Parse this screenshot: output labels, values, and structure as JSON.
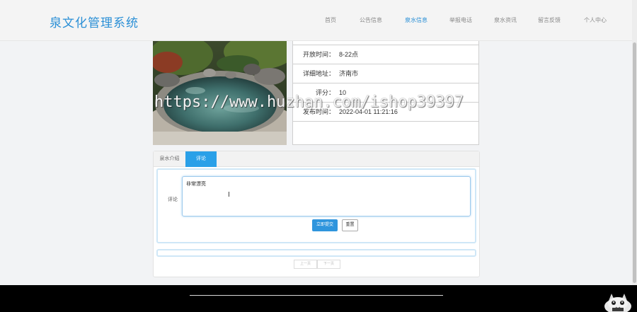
{
  "header": {
    "logo": "泉文化管理系统",
    "nav": [
      {
        "label": "首页",
        "active": false
      },
      {
        "label": "公告信息",
        "active": false
      },
      {
        "label": "泉水信息",
        "active": true
      },
      {
        "label": "举报电话",
        "active": false
      },
      {
        "label": "泉水资讯",
        "active": false
      },
      {
        "label": "留言反馈",
        "active": false
      },
      {
        "label": "个人中心",
        "active": false
      }
    ]
  },
  "details": {
    "rows": [
      {
        "label": "开放时间：",
        "value": "8-22点"
      },
      {
        "label": "详细地址：",
        "value": "济南市"
      },
      {
        "label": "评分：",
        "value": "10"
      },
      {
        "label": "发布时间：",
        "value": "2022-04-01 11:21:16"
      }
    ]
  },
  "tabs": {
    "intro": "泉水介绍",
    "comment": "评论"
  },
  "comment_form": {
    "label": "评论",
    "value": "非常漂亮",
    "submit": "立即提交",
    "reset": "重置"
  },
  "pager": {
    "prev": "上一页",
    "next": "下一页"
  },
  "watermark": "https://www.huzhan.com/ishop39397",
  "colors": {
    "accent": "#2a8fd6",
    "tab_active": "#2aa0e8",
    "footer": "#000000"
  }
}
